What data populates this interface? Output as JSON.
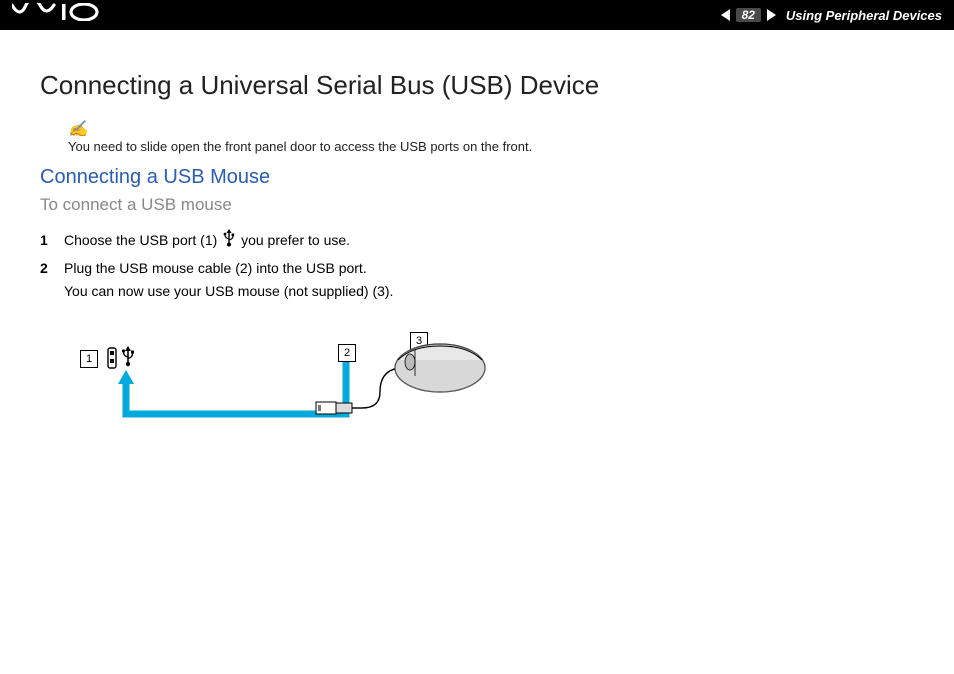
{
  "header": {
    "logo": "VAIO",
    "page_number": "82",
    "section": "Using Peripheral Devices"
  },
  "title": "Connecting a Universal Serial Bus (USB) Device",
  "note": "You need to slide open the front panel door to access the USB ports on the front.",
  "subsection": "Connecting a USB Mouse",
  "task_heading": "To connect a USB mouse",
  "steps": [
    {
      "num": "1",
      "text_before": "Choose the USB port (1) ",
      "text_after": " you prefer to use."
    },
    {
      "num": "2",
      "text_before": "Plug the USB mouse cable (2) into the USB port.\nYou can now use your USB mouse (not supplied) (3).",
      "text_after": ""
    }
  ],
  "callouts": {
    "c1": "1",
    "c2": "2",
    "c3": "3"
  }
}
